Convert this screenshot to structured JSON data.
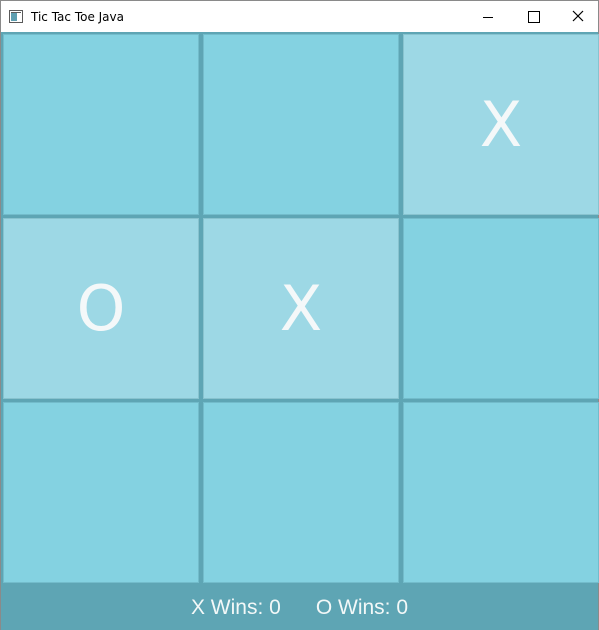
{
  "window": {
    "title": "Tic Tac Toe Java"
  },
  "board": {
    "cells": [
      "",
      "",
      "X",
      "O",
      "X",
      "",
      "",
      "",
      ""
    ]
  },
  "status": {
    "x_wins_label": "X Wins:",
    "x_wins": "0",
    "o_wins_label": "O Wins:",
    "o_wins": "0"
  },
  "colors": {
    "cell": "#84d2e1",
    "cell_played": "#9dd8e5",
    "grid": "#5ea5b4",
    "mark": "#f4f8f9"
  },
  "icons": {
    "app": "java-window-icon",
    "minimize": "minimize-icon",
    "maximize": "maximize-icon",
    "close": "close-icon"
  }
}
